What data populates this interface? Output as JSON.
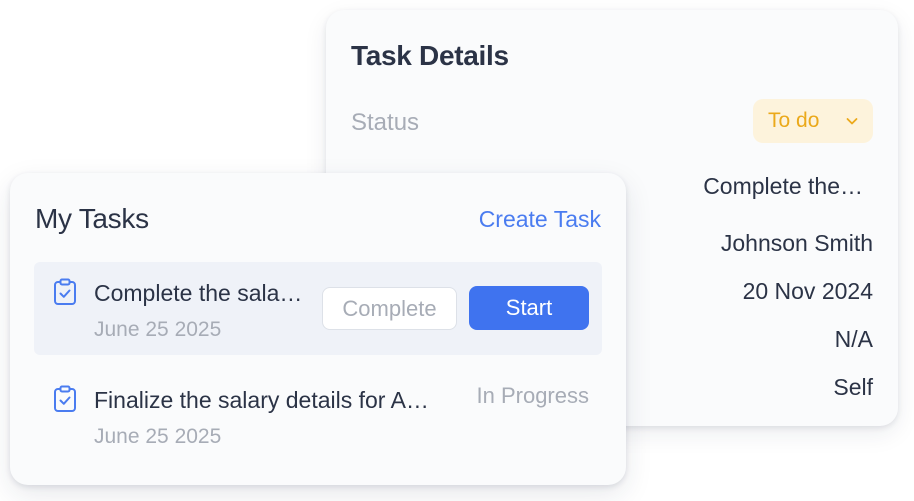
{
  "details": {
    "title": "Task Details",
    "status_label": "Status",
    "status_value": "To do",
    "task_name": "Complete the…",
    "assignee": "Johnson Smith",
    "due_date": "20 Nov 2024",
    "priority": "N/A",
    "assigned_by": "Self"
  },
  "tasks": {
    "title": "My Tasks",
    "create_label": "Create Task",
    "items": [
      {
        "name": "Complete the sala…",
        "date": "June 25 2025",
        "complete_label": "Complete",
        "start_label": "Start"
      },
      {
        "name": "Finalize the salary details for A…",
        "date": "June 25 2025",
        "status": "In Progress"
      }
    ]
  },
  "colors": {
    "accent": "#3f73ef",
    "link": "#4a7cf0",
    "status_bg": "#fdf3dc",
    "status_text": "#eba91b",
    "text_primary": "#2b3346",
    "text_muted": "#a7acb6"
  },
  "icons": {
    "task": "clipboard-check-icon",
    "dropdown": "chevron-down-icon"
  }
}
